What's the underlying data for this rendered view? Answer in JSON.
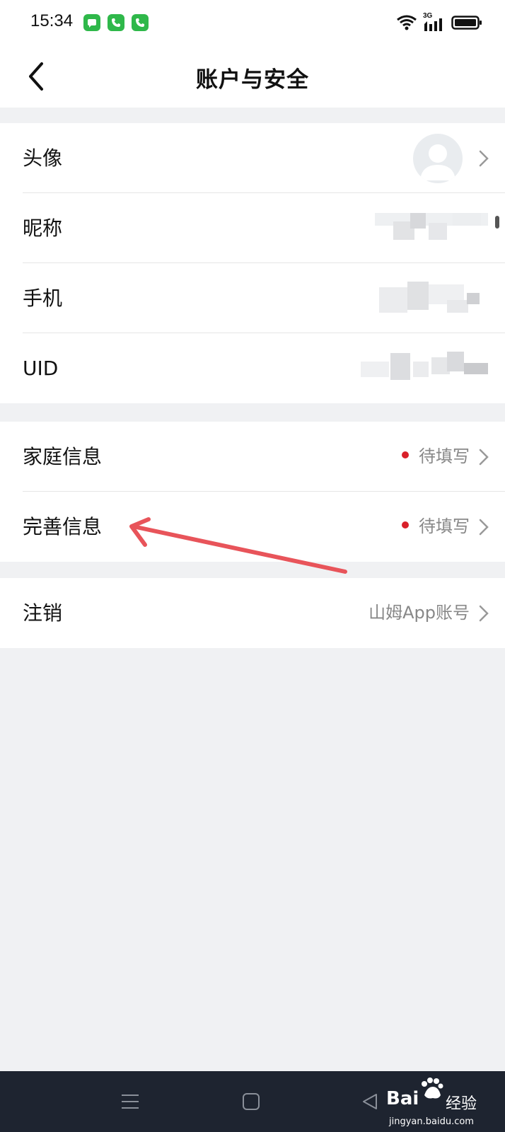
{
  "status_bar": {
    "time": "15:34",
    "network_label": "3G",
    "icons": [
      "message-app-icon",
      "phone-app-icon",
      "phone-app-icon",
      "wifi-icon",
      "signal-icon",
      "battery-icon"
    ]
  },
  "header": {
    "title": "账户与安全",
    "back_icon": "chevron-left-icon"
  },
  "profile_group": {
    "items": [
      {
        "label": "头像",
        "value_type": "avatar"
      },
      {
        "label": "昵称",
        "value_type": "blurred"
      },
      {
        "label": "手机",
        "value_type": "blurred"
      },
      {
        "label": "UID",
        "value_type": "blurred"
      }
    ]
  },
  "info_group": {
    "items": [
      {
        "label": "家庭信息",
        "value": "待填写",
        "status_color": "#d9202a"
      },
      {
        "label": "完善信息",
        "value": "待填写",
        "status_color": "#d9202a"
      }
    ]
  },
  "account_group": {
    "items": [
      {
        "label": "注销",
        "value": "山姆App账号"
      }
    ]
  },
  "system_nav": {
    "icons": [
      "menu-icon",
      "home-square-icon",
      "back-triangle-icon"
    ]
  },
  "watermark": {
    "brand": "Bai",
    "brand_suffix": "经验",
    "url": "jingyan.baidu.com"
  },
  "colors": {
    "accent_red": "#d9202a",
    "annotation_arrow": "#e8545a",
    "background": "#f0f1f3",
    "nav_bar": "#1e2430"
  }
}
